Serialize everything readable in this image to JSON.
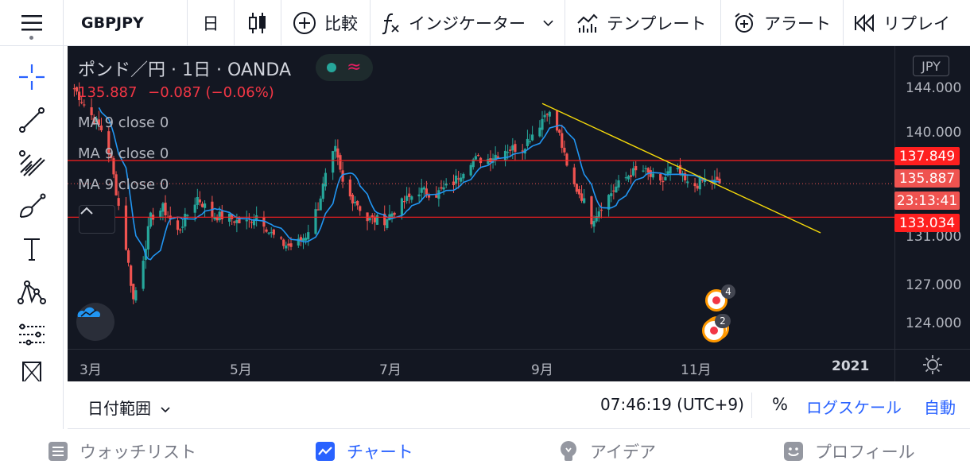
{
  "topbar": {
    "symbol": "GBPJPY",
    "interval": "日",
    "compare_label": "比較",
    "indicators_label": "インジケーター",
    "templates_label": "テンプレート",
    "alert_label": "アラート",
    "replay_label": "リプレイ"
  },
  "legend": {
    "title": "ポンド／円 · 1日 · OANDA",
    "price": "135.887",
    "change": "−0.087 (−0.06%)",
    "ma_lines": [
      "MA 9 close 0",
      "MA 9 close 0",
      "MA 9 close 0"
    ]
  },
  "price_axis": {
    "currency": "JPY",
    "labels": [
      "144.000",
      "140.000",
      "131.000",
      "127.000",
      "124.000"
    ],
    "tags": {
      "resistance": "137.849",
      "last_price": "135.887",
      "countdown": "23:13:41",
      "support": "133.034"
    }
  },
  "time_axis": {
    "labels": [
      "3月",
      "5月",
      "7月",
      "9月",
      "11月",
      "2021"
    ]
  },
  "events": {
    "upper_count": "4",
    "lower_count": "2"
  },
  "bottombar": {
    "date_range": "日付範囲",
    "time": "07:46:19 (UTC+9)",
    "percent": "%",
    "log_scale": "ログスケール",
    "auto": "自動"
  },
  "nav": {
    "watchlist": "ウォッチリスト",
    "chart": "チャート",
    "ideas": "アイデア",
    "profile": "プロフィール"
  },
  "colors": {
    "background": "#131722",
    "up": "#26a69a",
    "down": "#ef5350",
    "ma": "#2196f3",
    "trendline": "#f5d90a",
    "hline": "#ff1f1f",
    "accent": "#2962ff"
  },
  "chart_data": {
    "type": "candlestick",
    "symbol": "GBPJPY",
    "ylim": [
      123,
      146
    ],
    "hlines": [
      137.849,
      133.034
    ],
    "last_price": 135.887,
    "trendline": [
      [
        "2020-09-01",
        142.7
      ],
      [
        "2020-12-23",
        131.7
      ]
    ],
    "close_path": [
      [
        "2020-02-24",
        144.0
      ],
      [
        "2020-03-01",
        142.0
      ],
      [
        "2020-03-07",
        140.2
      ],
      [
        "2020-03-10",
        137.8
      ],
      [
        "2020-03-13",
        134.0
      ],
      [
        "2020-03-16",
        130.5
      ],
      [
        "2020-03-19",
        126.0
      ],
      [
        "2020-03-22",
        128.5
      ],
      [
        "2020-03-26",
        133.0
      ],
      [
        "2020-03-31",
        133.8
      ],
      [
        "2020-04-06",
        131.8
      ],
      [
        "2020-04-14",
        134.7
      ],
      [
        "2020-04-20",
        133.2
      ],
      [
        "2020-04-27",
        133.0
      ],
      [
        "2020-05-03",
        132.4
      ],
      [
        "2020-05-09",
        133.4
      ],
      [
        "2020-05-13",
        131.8
      ],
      [
        "2020-05-18",
        130.8
      ],
      [
        "2020-05-23",
        130.5
      ],
      [
        "2020-05-28",
        131.5
      ],
      [
        "2020-06-02",
        134.0
      ],
      [
        "2020-06-06",
        137.3
      ],
      [
        "2020-06-09",
        138.7
      ],
      [
        "2020-06-13",
        135.0
      ],
      [
        "2020-06-17",
        134.5
      ],
      [
        "2020-06-22",
        132.8
      ],
      [
        "2020-06-29",
        132.8
      ],
      [
        "2020-07-06",
        134.2
      ],
      [
        "2020-07-13",
        135.3
      ],
      [
        "2020-07-20",
        135.0
      ],
      [
        "2020-07-27",
        136.0
      ],
      [
        "2020-08-03",
        137.9
      ],
      [
        "2020-08-10",
        138.0
      ],
      [
        "2020-08-17",
        138.8
      ],
      [
        "2020-08-24",
        139.0
      ],
      [
        "2020-08-31",
        141.0
      ],
      [
        "2020-09-03",
        142.2
      ],
      [
        "2020-09-08",
        140.0
      ],
      [
        "2020-09-12",
        136.3
      ],
      [
        "2020-09-17",
        134.8
      ],
      [
        "2020-09-21",
        132.8
      ],
      [
        "2020-09-25",
        134.0
      ],
      [
        "2020-09-30",
        135.4
      ],
      [
        "2020-10-07",
        136.8
      ],
      [
        "2020-10-12",
        137.0
      ],
      [
        "2020-10-19",
        135.8
      ],
      [
        "2020-10-24",
        137.4
      ],
      [
        "2020-10-31",
        135.5
      ],
      [
        "2020-11-06",
        136.2
      ],
      [
        "2020-11-12",
        135.9
      ]
    ]
  }
}
